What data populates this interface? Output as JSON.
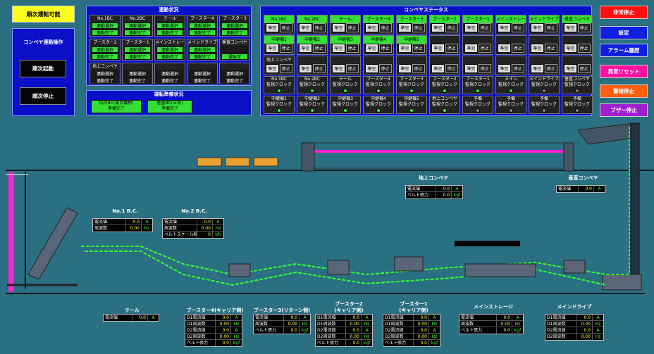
{
  "top_left": {
    "sequential_ready": "順次運転可能"
  },
  "conveyor_ops": {
    "title": "コンベヤ連動操作",
    "start": "順次起動",
    "stop": "順次停止"
  },
  "linkage": {
    "title": "連動状況",
    "rows": [
      [
        {
          "label": "No.1BC",
          "s1": "連動選択",
          "s2": "連動完了"
        },
        {
          "label": "No.2BC",
          "s1": "連動選択",
          "s2": "連動完了"
        },
        {
          "label": "テール",
          "s1": "連動選択",
          "s2": "連動完了"
        },
        {
          "label": "ブースター4",
          "s1": "連動選択",
          "s2": "連動完了"
        },
        {
          "label": "ブースター3",
          "s1": "連動選択",
          "s2": "連動完了"
        }
      ],
      [
        {
          "label": "ブースター2",
          "s1": "連動選択",
          "s2": "連動完了"
        },
        {
          "label": "ブースター1",
          "s1": "連動選択",
          "s2": "連動完了"
        },
        {
          "label": "メインストレージ",
          "s1": "連動選択",
          "s2": "連動完了"
        },
        {
          "label": "メインドライブ",
          "s1": "連動選択",
          "s2": "連動完了"
        },
        {
          "label": "垂直コンベヤ",
          "s1": "",
          "s2": "運転可"
        }
      ],
      [
        {
          "label": "地上コンベヤ",
          "s1": "連動選択",
          "s2": "連動完了"
        },
        {
          "label": "",
          "s1": "連動選択",
          "s2": "連動完了"
        },
        {
          "label": "",
          "s1": "連動選択",
          "s2": "連動完了"
        },
        {
          "label": "",
          "s1": "連動選択",
          "s2": "連動完了"
        },
        {
          "label": "",
          "s1": "連動選択",
          "s2": "連動完了"
        }
      ]
    ]
  },
  "prep": {
    "title": "運転準備状況",
    "a": "坑内BC(東京機材)\n準備完了",
    "b": "垂直BC(三央)\n準備完了"
  },
  "status": {
    "title": "コンベヤステータス",
    "row1": [
      "No.1BC",
      "No.2BC",
      "テール",
      "ブースター4",
      "ブースター3",
      "ブースター2",
      "ブースター1",
      "メインストレージ",
      "メインドライブ",
      "垂直コンベヤ"
    ],
    "row2": [
      "中継機1",
      "中継機2",
      "中継機3",
      "中継機4",
      "中継機5"
    ],
    "row3": [
      "地上コンベヤ"
    ],
    "ready": "準完",
    "stop": "停止",
    "mon1": [
      "No.1BC\n監視クロック",
      "No.2BC\n監視クロック",
      "テール\n監視クロック",
      "ブースター4\n監視クロック",
      "ブースター3\n監視クロック",
      "ブースター2\n監視クロック",
      "ブースター1\n監視クロック",
      "メイン\n監視クロック",
      "メインドライブ\n監視クロック",
      "垂直コンベヤ\n監視クロック"
    ],
    "mon2": [
      "中継機1\n監視クロック",
      "中継機2\n監視クロック",
      "中継機3\n監視クロック",
      "中継機4\n監視クロック",
      "中継機5\n監視クロック",
      "地上コンベヤ\n監視クロック",
      "予備\n監視クロック",
      "予備\n監視クロック",
      "予備\n監視クロック",
      "予備\n監視クロック"
    ]
  },
  "right_buttons": [
    "非常停止",
    "設定",
    "アラーム履歴",
    "異常リセット",
    "警報停止",
    "ブザー停止"
  ],
  "right_colors": [
    "#ff1010",
    "#1020e0",
    "#1020e0",
    "#ff10a0",
    "#ff6010",
    "#a020d0"
  ],
  "labels": {
    "ground": "地上コンベヤ",
    "vertical": "垂直コンベヤ",
    "bc1": "No.1 B.C.",
    "bc2": "No.2 B.C.",
    "tail": "テール",
    "b4": "ブースター4(キャリア側)",
    "b3": "ブースター3(リターン側)",
    "b2": "ブースター2\n(キャリア側)",
    "b1": "ブースター1\n(キャリア側)",
    "ms": "メインストレージ",
    "md": "メインドライブ"
  },
  "meters": {
    "ground": [
      [
        "電流値",
        "0.0",
        "A"
      ],
      [
        "ベルト張力",
        "0.0",
        "kgf"
      ]
    ],
    "vertical": [
      [
        "電流値",
        "0.0",
        "A"
      ]
    ],
    "bc1": [
      [
        "電流値",
        "0.0",
        "A"
      ],
      [
        "周波数",
        "0.00",
        "Hz"
      ]
    ],
    "bc2": [
      [
        "電流値",
        "0.0",
        "A"
      ],
      [
        "周波数",
        "0.00",
        "Hz"
      ],
      [
        "ベルトスケール積算",
        "0",
        "t/h"
      ]
    ],
    "tail": [
      [
        "電流値",
        "0.0",
        "A"
      ]
    ],
    "b4": [
      [
        "D1電流値",
        "0.0",
        "A"
      ],
      [
        "D1周波数",
        "0.00",
        "Hz"
      ],
      [
        "D2電流値",
        "0.0",
        "A"
      ],
      [
        "D2周波数",
        "0.00",
        "Hz"
      ],
      [
        "ベルト張力",
        "0.0",
        "kgf"
      ]
    ],
    "b3": [
      [
        "電流値",
        "0.0",
        "A"
      ],
      [
        "周波数",
        "0.00",
        "Hz"
      ],
      [
        "ベルト張力",
        "0.0",
        "kgf"
      ]
    ],
    "b2": [
      [
        "D1電流値",
        "0.0",
        "A"
      ],
      [
        "D1周波数",
        "0.00",
        "Hz"
      ],
      [
        "D2電流値",
        "0.0",
        "A"
      ],
      [
        "D2周波数",
        "0.00",
        "Hz"
      ],
      [
        "ベルト張力",
        "0.0",
        "kgf"
      ]
    ],
    "b1": [
      [
        "D1電流値",
        "0.0",
        "A"
      ],
      [
        "D1周波数",
        "0.00",
        "Hz"
      ],
      [
        "D2電流値",
        "0.0",
        "A"
      ],
      [
        "D2周波数",
        "0.00",
        "Hz"
      ],
      [
        "ベルト張力",
        "0.0",
        "kgf"
      ]
    ],
    "ms": [
      [
        "電流値",
        "0.0",
        "A"
      ],
      [
        "周波数",
        "0.00",
        "Hz"
      ],
      [
        "ベルト張力",
        "0.0",
        "kgf"
      ]
    ],
    "md": [
      [
        "D1電流値",
        "0.0",
        "A"
      ],
      [
        "D1周波数",
        "0.00",
        "Hz"
      ],
      [
        "D2電流値",
        "0.0",
        "A"
      ],
      [
        "D2周波数",
        "0.00",
        "Hz"
      ]
    ]
  }
}
